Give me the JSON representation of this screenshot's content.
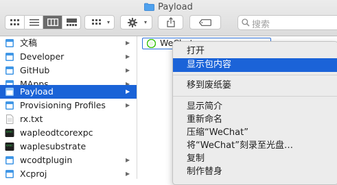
{
  "window": {
    "title": "Payload"
  },
  "toolbar": {
    "view_buttons": [
      "icon-view",
      "list-view",
      "column-view",
      "gallery-view"
    ],
    "selected_view": "column-view",
    "group_caret": "▾",
    "action_caret": "▾",
    "search_placeholder": "搜索"
  },
  "sidebar": {
    "items": [
      {
        "label": "文稿",
        "icon": "folder-icon",
        "arrow": "▶"
      },
      {
        "label": "Developer",
        "icon": "folder-icon",
        "arrow": "▶"
      },
      {
        "label": "GitHub",
        "icon": "folder-icon",
        "arrow": "▶"
      },
      {
        "label": "MApps",
        "icon": "folder-icon",
        "arrow": "▶"
      },
      {
        "label": "Payload",
        "icon": "folder-icon",
        "arrow": "▶",
        "selected": true
      },
      {
        "label": "Provisioning Profiles",
        "icon": "folder-icon",
        "arrow": "▶"
      },
      {
        "label": "rx.txt",
        "icon": "text-file-icon",
        "arrow": ""
      },
      {
        "label": "wapleodtcorexpc",
        "icon": "terminal-exec-icon",
        "arrow": ""
      },
      {
        "label": "waplesubstrate",
        "icon": "terminal-exec-icon",
        "arrow": ""
      },
      {
        "label": "wcodtplugin",
        "icon": "folder-icon",
        "arrow": "▶"
      },
      {
        "label": "Xcproj",
        "icon": "folder-icon",
        "arrow": "▶"
      }
    ]
  },
  "column2": {
    "item": {
      "label": "WeChat",
      "icon": "wechat-app-icon"
    }
  },
  "context_menu": {
    "items": [
      {
        "label": "打开"
      },
      {
        "label": "显示包内容",
        "highlighted": true
      },
      {
        "separator": true
      },
      {
        "label": "移到废纸篓"
      },
      {
        "separator": true
      },
      {
        "label": "显示简介"
      },
      {
        "label": "重新命名"
      },
      {
        "label": "压缩“WeChat”"
      },
      {
        "label": "将“WeChat”刻录至光盘…"
      },
      {
        "label": "复制"
      },
      {
        "label": "制作替身"
      }
    ]
  },
  "colors": {
    "selection": "#1a63d7",
    "folder": "#3f96e6"
  }
}
